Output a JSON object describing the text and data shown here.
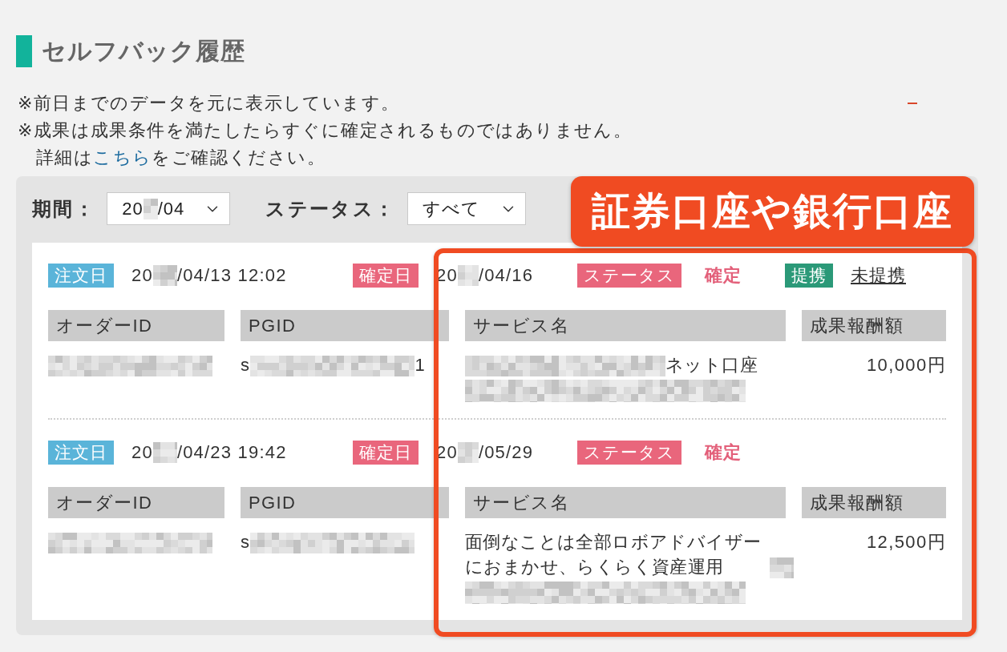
{
  "title": "セルフバック履歴",
  "notes": [
    "※前日までのデータを元に表示しています。",
    "※成果は成果条件を満たしたらすぐに確定されるものではありません。"
  ],
  "detail_note": {
    "before": "詳細は",
    "link": "こちら",
    "after": "をご確認ください。"
  },
  "filters": [
    {
      "label": "期間：",
      "value": [
        {
          "kind": "text",
          "text": "20"
        },
        {
          "kind": "blur"
        },
        {
          "kind": "text",
          "text": "/04"
        }
      ]
    },
    {
      "label": "ステータス：",
      "value": [
        {
          "kind": "text",
          "text": "すべて"
        }
      ]
    }
  ],
  "orders": [
    {
      "order_date_label": "注文日",
      "order_date": [
        {
          "kind": "text",
          "text": "20"
        },
        {
          "kind": "blur"
        },
        {
          "kind": "text",
          "text": "/04/13 12:02"
        }
      ],
      "confirm_date_label": "確定日",
      "confirm_date": [
        {
          "kind": "text",
          "text": "20"
        },
        {
          "kind": "blur"
        },
        {
          "kind": "text",
          "text": "/04/16"
        }
      ],
      "status_label": "ステータス",
      "status": "確定",
      "partner_label": "提携",
      "partner": "未提携",
      "columns": [
        "オーダーID",
        "PGID",
        "サービス名",
        "成果報酬額"
      ],
      "order_id": [
        {
          "kind": "blur"
        }
      ],
      "pgid": [
        {
          "kind": "text",
          "text": "s"
        },
        {
          "kind": "blur"
        },
        {
          "kind": "text",
          "text": "1"
        }
      ],
      "service": [
        {
          "kind": "blur"
        },
        {
          "kind": "text",
          "text": "ネット口座"
        },
        {
          "kind": "blurline"
        }
      ],
      "reward": "10,000円"
    },
    {
      "order_date_label": "注文日",
      "order_date": [
        {
          "kind": "text",
          "text": "20"
        },
        {
          "kind": "blur"
        },
        {
          "kind": "text",
          "text": "/04/23 19:42"
        }
      ],
      "confirm_date_label": "確定日",
      "confirm_date": [
        {
          "kind": "text",
          "text": "20"
        },
        {
          "kind": "blur"
        },
        {
          "kind": "text",
          "text": "/05/29"
        }
      ],
      "status_label": "ステータス",
      "status": "確定",
      "columns": [
        "オーダーID",
        "PGID",
        "サービス名",
        "成果報酬額"
      ],
      "order_id": [
        {
          "kind": "blur"
        }
      ],
      "pgid": [
        {
          "kind": "text",
          "text": "s"
        },
        {
          "kind": "blur"
        }
      ],
      "service": [
        {
          "kind": "text",
          "text": "面倒なことは全部ロボアドバイザーにおまかせ、らくらく資産運用"
        },
        {
          "kind": "blur"
        },
        {
          "kind": "blurline"
        }
      ],
      "reward": "12,500円"
    }
  ],
  "annotation": {
    "label": "証券口座や銀行口座"
  }
}
